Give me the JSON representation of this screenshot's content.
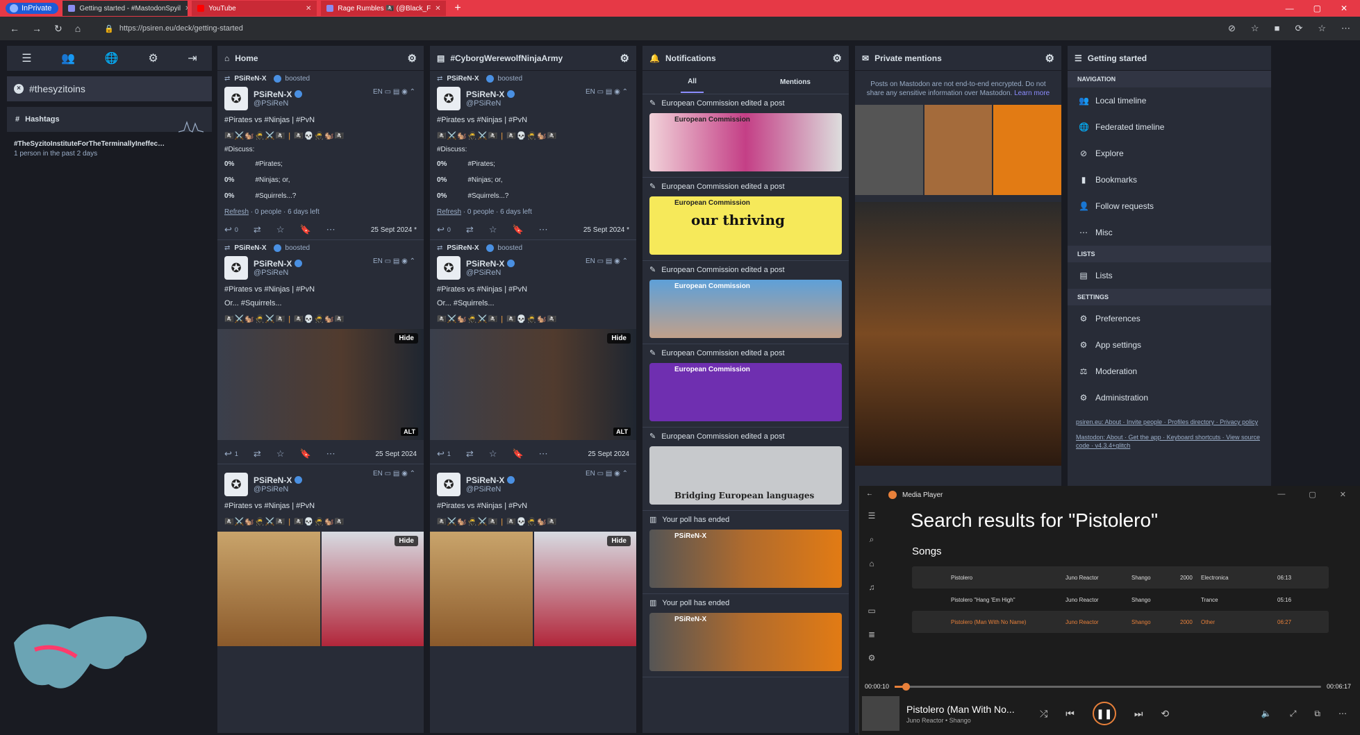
{
  "browser": {
    "inprivate": "InPrivate",
    "tabs": [
      {
        "title": "Getting started - #MastodonSpyil",
        "active": true
      },
      {
        "title": "YouTube",
        "active": false
      },
      {
        "title": "Rage Rumbles 🏴‍☠️ (@Black_F",
        "active": false
      }
    ],
    "url": "https://psiren.eu/deck/getting-started"
  },
  "drawer": {
    "hashtag_pill": "#thesyzitoins",
    "hashtags_label": "Hashtags",
    "trend_name": "#TheSyzitoInstituteForTheTerminallyIneffec…",
    "trend_sub": "1 person in the past 2 days"
  },
  "columns": {
    "home": {
      "title": "Home"
    },
    "cyborg": {
      "title": "#CyborgWerewolfNinjaArmy"
    },
    "notifications": {
      "title": "Notifications",
      "tab_all": "All",
      "tab_mentions": "Mentions"
    },
    "private": {
      "title": "Private mentions",
      "warn": "Posts on Mastodon are not end-to-end encrypted. Do not share any sensitive information over Mastodon.",
      "learn_more": "Learn more"
    },
    "getting_started": {
      "title": "Getting started"
    }
  },
  "post": {
    "boosted_by": "PSiReN-X",
    "boosted": "boosted",
    "name": "PSiReN-X",
    "handle": "@PSiReN",
    "lang": "EN",
    "text1": "#Pirates vs #Ninjas | #PvN",
    "discuss": "#Discuss:",
    "opt1_pct": "0%",
    "opt1": "#Pirates;",
    "opt2_pct": "0%",
    "opt2": "#Ninjas; or,",
    "opt3_pct": "0%",
    "opt3": "#Squirrels...?",
    "refresh": "Refresh",
    "poll_meta": "· 0 people · 6 days left",
    "reply_count": "0",
    "date_star": "25 Sept 2024 *",
    "text2": "Or... #Squirrels...",
    "hide": "Hide",
    "alt": "ALT",
    "reply_count2": "1",
    "date": "25 Sept 2024"
  },
  "notifs": [
    {
      "label": "European Commission edited a post",
      "name": "European Commission"
    },
    {
      "label": "European Commission edited a post",
      "name": "European Commission",
      "big": "our thriving"
    },
    {
      "label": "European Commission edited a post",
      "name": "European Commission"
    },
    {
      "label": "European Commission edited a post",
      "name": "European Commission"
    },
    {
      "label": "European Commission edited a post",
      "name": "Bridging European languages"
    },
    {
      "label": "Your poll has ended",
      "name": "PSiReN-X"
    },
    {
      "label": "Your poll has ended",
      "name": "PSiReN-X"
    }
  ],
  "getting_started": {
    "navigation": "NAVIGATION",
    "items": [
      "Local timeline",
      "Federated timeline",
      "Explore",
      "Bookmarks",
      "Follow requests",
      "Misc"
    ],
    "lists": "LISTS",
    "lists_item": "Lists",
    "settings": "SETTINGS",
    "settings_items": [
      "Preferences",
      "App settings",
      "Moderation",
      "Administration"
    ],
    "footer1": "psiren.eu: About · Invite people · Profiles directory · Privacy policy",
    "footer2": "Mastodon: About · Get the app · Keyboard shortcuts · View source code · v4.3.4+glitch"
  },
  "player": {
    "app": "Media Player",
    "title": "Search results for \"Pistolero\"",
    "songs_label": "Songs",
    "songs": [
      {
        "title": "Pistolero",
        "artist": "Juno Reactor",
        "album": "Shango",
        "year": "2000",
        "genre": "Electronica",
        "dur": "06:13"
      },
      {
        "title": "Pistolero \"Hang 'Em High\"",
        "artist": "Juno Reactor",
        "album": "Shango",
        "year": "",
        "genre": "Trance",
        "dur": "05:16"
      },
      {
        "title": "Pistolero (Man With No Name)",
        "artist": "Juno Reactor",
        "album": "Shango",
        "year": "2000",
        "genre": "Other",
        "dur": "06:27"
      }
    ],
    "elapsed": "00:00:10",
    "total": "00:06:17",
    "progress": 0.026,
    "np_title": "Pistolero (Man With No...",
    "np_sub": "Juno Reactor • Shango"
  },
  "colors": {
    "accent": "#8c8dff",
    "player_accent": "#e8803a",
    "tabbar": "#e63946"
  }
}
